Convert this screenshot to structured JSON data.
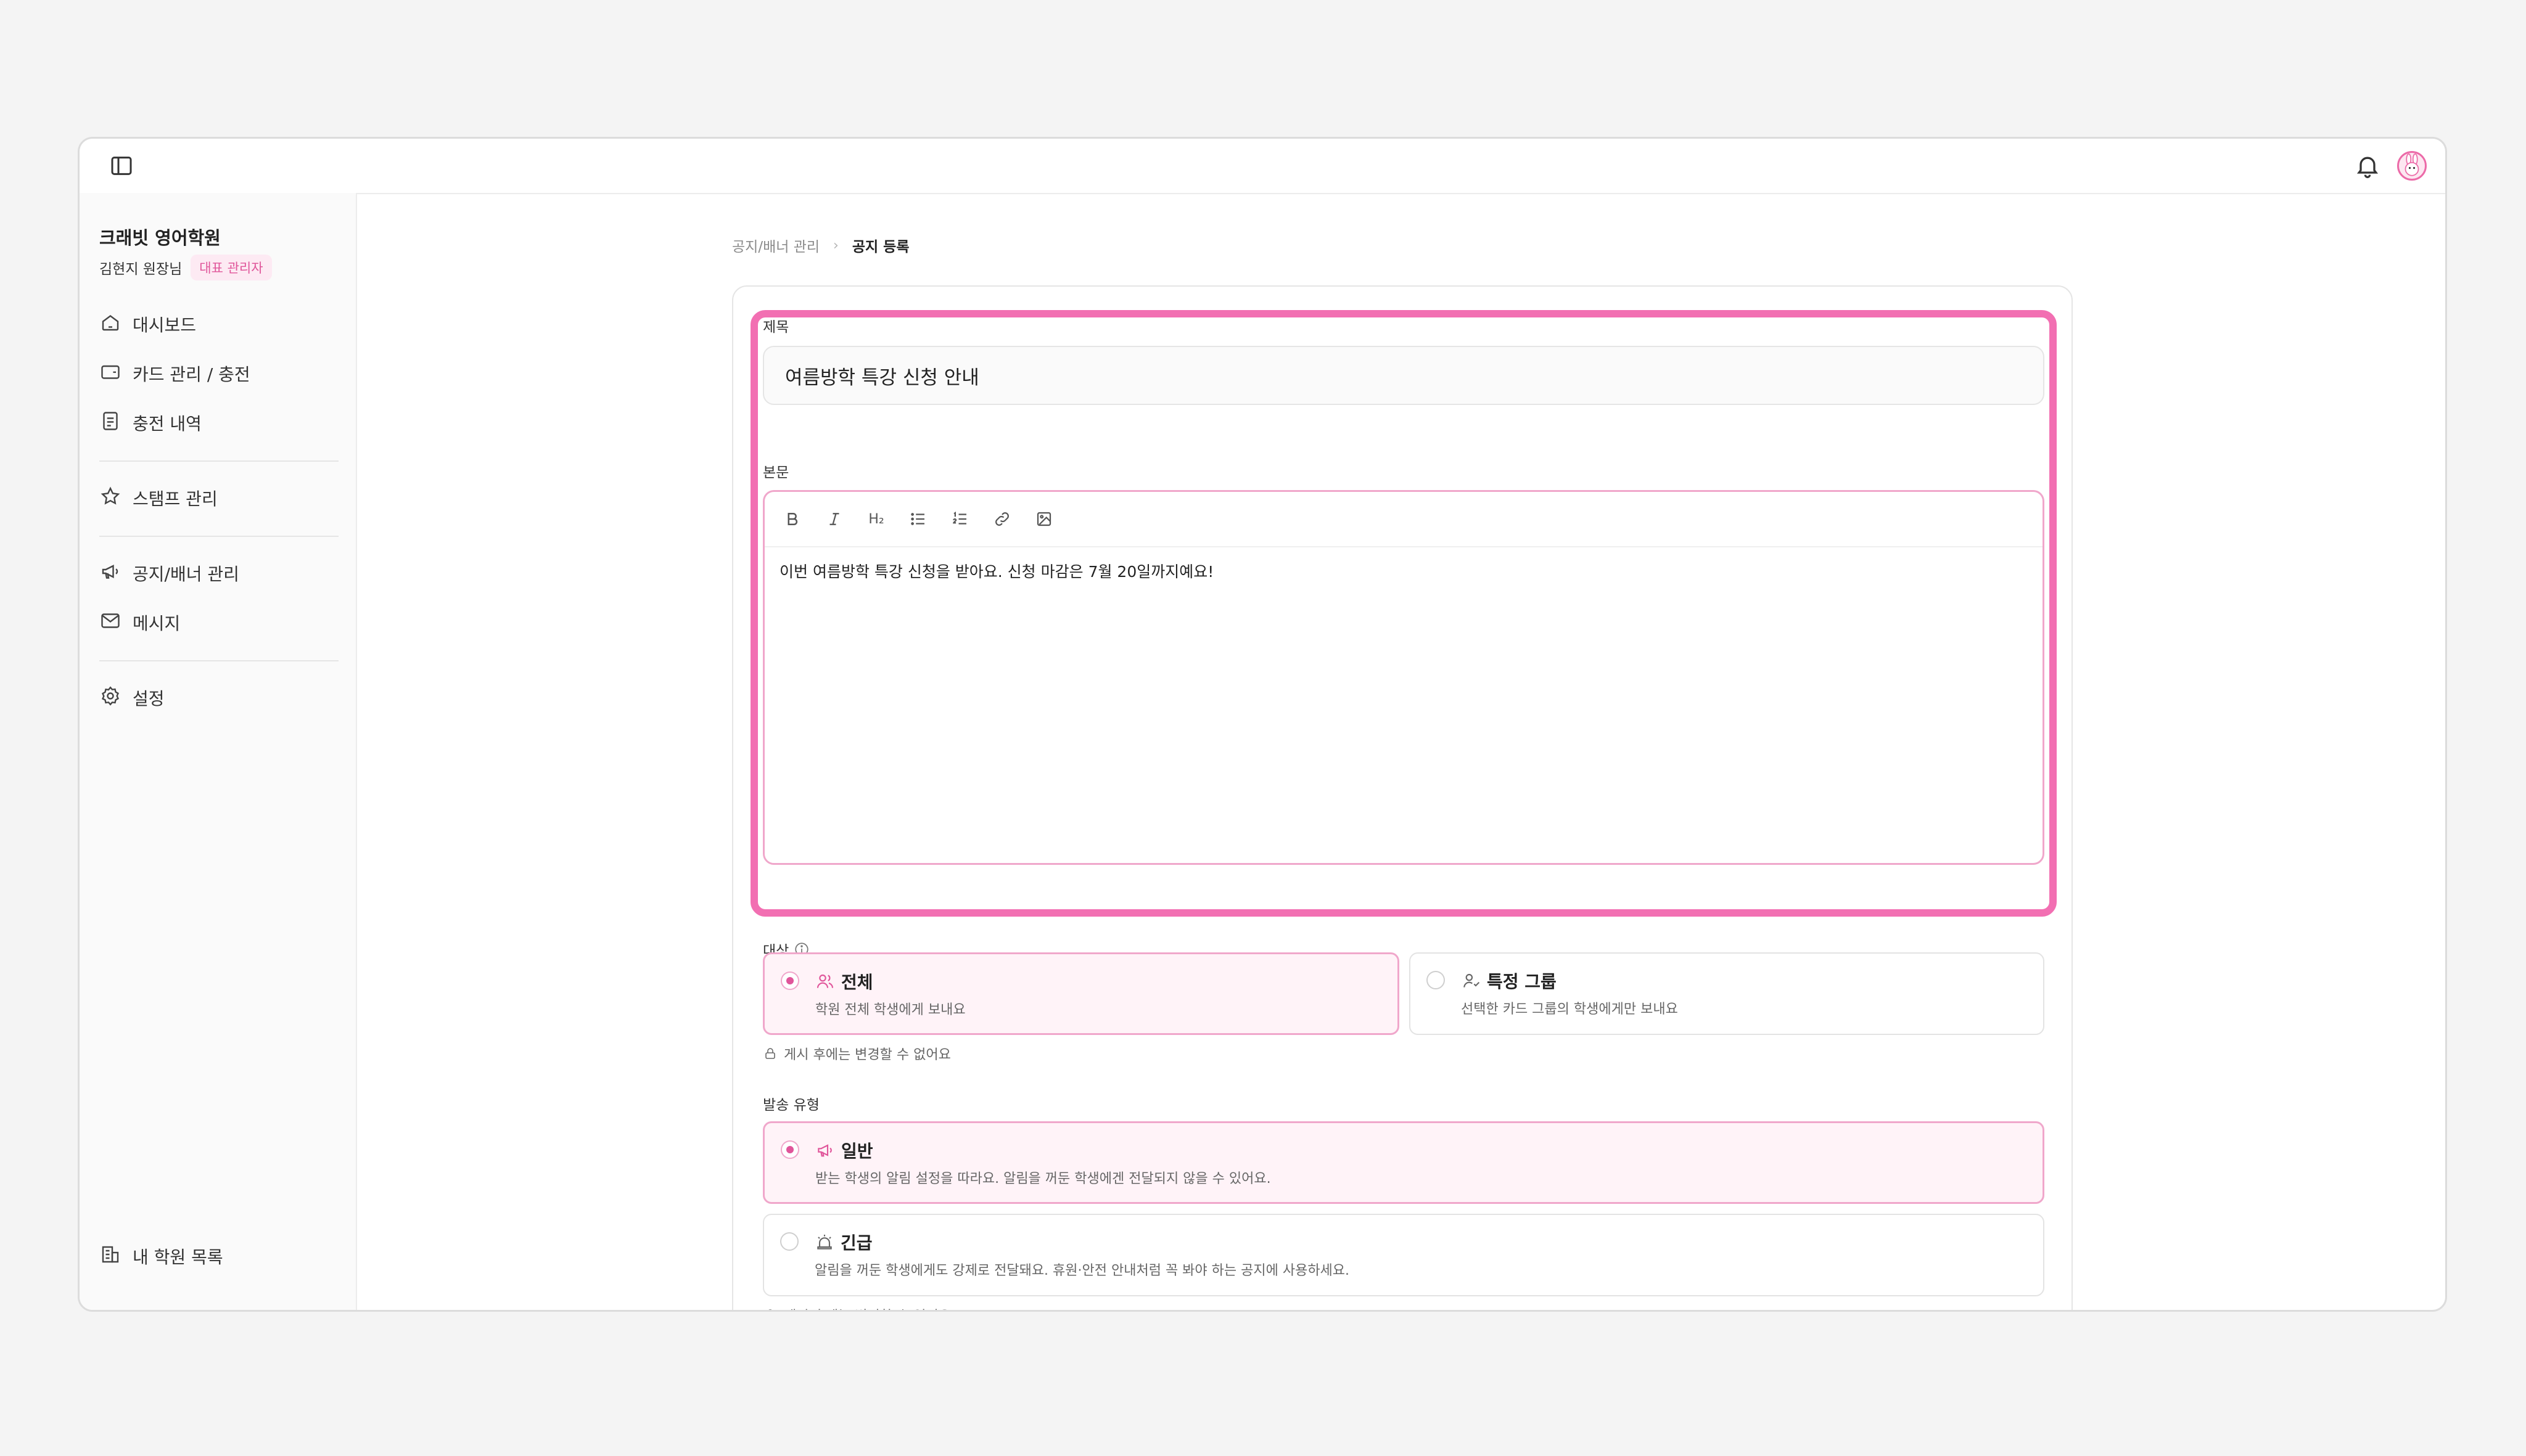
{
  "header": {
    "sidebar_toggle_icon": "sidebar-toggle-icon",
    "bell_icon": "bell-icon",
    "avatar_icon": "rabbit-avatar"
  },
  "sidebar": {
    "academy_name": "크래빗 영어학원",
    "user_name": "김현지 원장님",
    "role_badge": "대표 관리자",
    "items": [
      {
        "label": "대시보드",
        "icon": "home-icon"
      },
      {
        "label": "카드 관리 / 충전",
        "icon": "wallet-icon"
      },
      {
        "label": "충전 내역",
        "icon": "receipt-icon"
      },
      {
        "label": "스탬프 관리",
        "icon": "star-icon"
      },
      {
        "label": "공지/배너 관리",
        "icon": "megaphone-icon"
      },
      {
        "label": "메시지",
        "icon": "mail-icon"
      },
      {
        "label": "설정",
        "icon": "gear-icon"
      }
    ],
    "footer_item": {
      "label": "내 학원 목록",
      "icon": "building-icon"
    }
  },
  "breadcrumb": {
    "parent": "공지/배너 관리",
    "separator": "›",
    "current": "공지 등록"
  },
  "form": {
    "title_label": "제목",
    "title_value": "여름방학 특강 신청 안내",
    "body_label": "본문",
    "toolbar": [
      "bold",
      "italic",
      "H₂",
      "bullet-list",
      "ordered-list",
      "link",
      "image"
    ],
    "heading_button": "H₂",
    "body_value": "이번 여름방학 특강 신청을 받아요. 신청 마감은 7월 20일까지예요!",
    "target_label": "대상",
    "target_options": [
      {
        "title": "전체",
        "desc": "학원 전체 학생에게 보내요",
        "selected": true,
        "icon": "users-icon"
      },
      {
        "title": "특정 그룹",
        "desc": "선택한 카드 그룹의 학생에게만 보내요",
        "selected": false,
        "icon": "user-group-icon"
      }
    ],
    "target_note": "게시 후에는 변경할 수 없어요",
    "send_type_label": "발송 유형",
    "send_type_options": [
      {
        "title": "일반",
        "desc": "받는 학생의 알림 설정을 따라요. 알림을 꺼둔 학생에겐 전달되지 않을 수 있어요.",
        "selected": true,
        "icon": "megaphone-icon"
      },
      {
        "title": "긴급",
        "desc": "알림을 꺼둔 학생에게도 강제로 전달돼요. 휴원·안전 안내처럼 꼭 봐야 하는 공지에 사용하세요.",
        "selected": false,
        "icon": "siren-icon"
      }
    ],
    "send_type_note": "게시 후에는 변경할 수 없어요"
  },
  "colors": {
    "accent": "#e0559a",
    "highlight": "#f26fb2",
    "selected_bg": "#fff3f8"
  }
}
